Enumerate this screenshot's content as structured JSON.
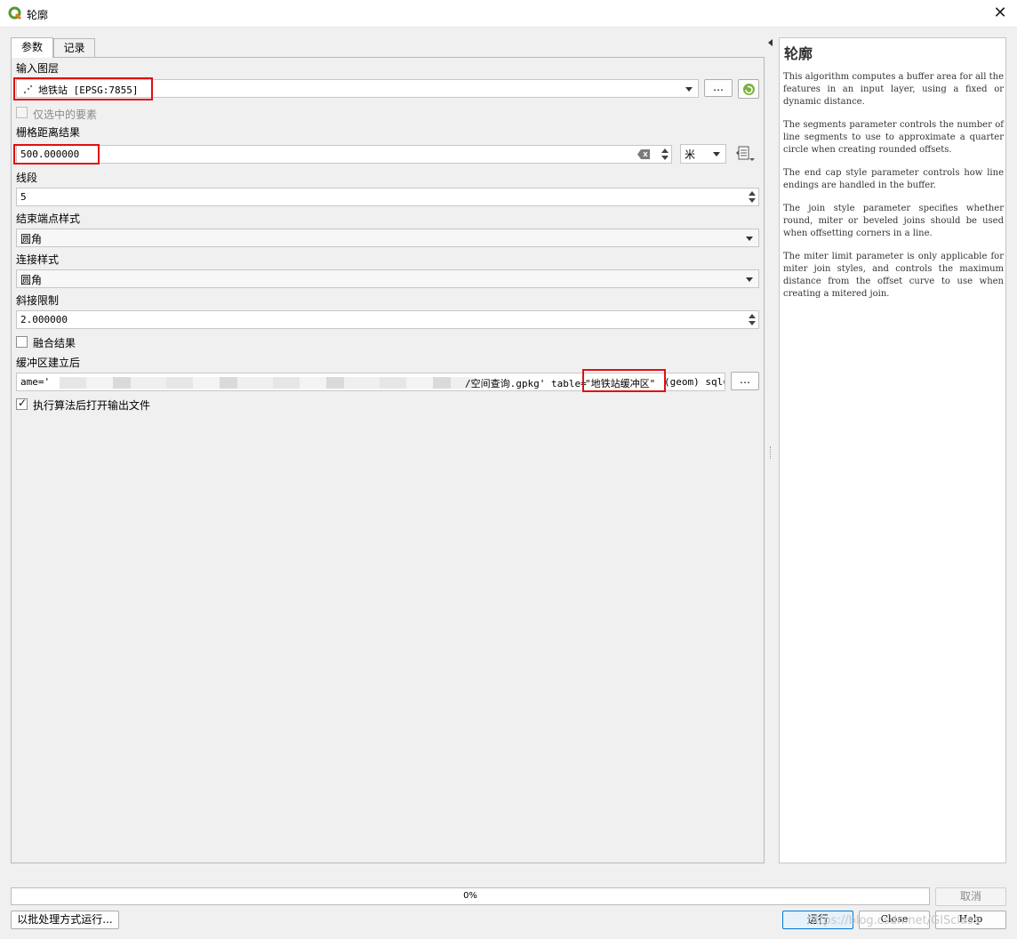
{
  "window": {
    "title": "轮廓",
    "close_glyph": "✕"
  },
  "tabs": [
    {
      "label": "参数"
    },
    {
      "label": "记录"
    }
  ],
  "params": {
    "input_layer": {
      "label": "输入图层",
      "value": "地铁站 [EPSG:7855]",
      "browse": "…"
    },
    "selected_only": {
      "label": "仅选中的要素",
      "checked": false
    },
    "distance": {
      "label": "栅格距离结果",
      "value": "500.000000",
      "unit": "米"
    },
    "segments": {
      "label": "线段",
      "value": "5"
    },
    "end_cap": {
      "label": "结束端点样式",
      "value": "圆角"
    },
    "join_style": {
      "label": "连接样式",
      "value": "圆角"
    },
    "miter_limit": {
      "label": "斜接限制",
      "value": "2.000000"
    },
    "dissolve": {
      "label": "融合结果",
      "checked": false
    },
    "output": {
      "label": "缓冲区建立后",
      "prefix": "ame='",
      "middle": "/空间查询.gpkg' table=",
      "table": "\"地铁站缓冲区\"",
      "suffix": " (geom) sql=",
      "browse": "…"
    },
    "open_output": {
      "label": "执行算法后打开输出文件",
      "checked": true
    }
  },
  "help": {
    "title": "轮廓",
    "paragraphs": [
      "This algorithm computes a buffer area for all the features in an input layer, using a fixed or dynamic distance.",
      "The segments parameter controls the number of line segments to use to approximate a quarter circle when creating rounded offsets.",
      "The end cap style parameter controls how line endings are handled in the buffer.",
      "The join style parameter specifies whether round, miter or beveled joins should be used when offsetting corners in a line.",
      "The miter limit parameter is only applicable for miter join styles, and controls the maximum distance from the offset curve to use when creating a mitered join."
    ]
  },
  "progress": {
    "text": "0%",
    "value": 0
  },
  "buttons": {
    "cancel": "取消",
    "batch": "以批处理方式运行...",
    "run": "运行",
    "close": "Close",
    "help": "Help"
  },
  "watermark": "https://blog.csdn.net/GISclass",
  "colors": {
    "accent": "#0078d7",
    "highlight": "#e01010",
    "qgis_green": "#589632"
  }
}
